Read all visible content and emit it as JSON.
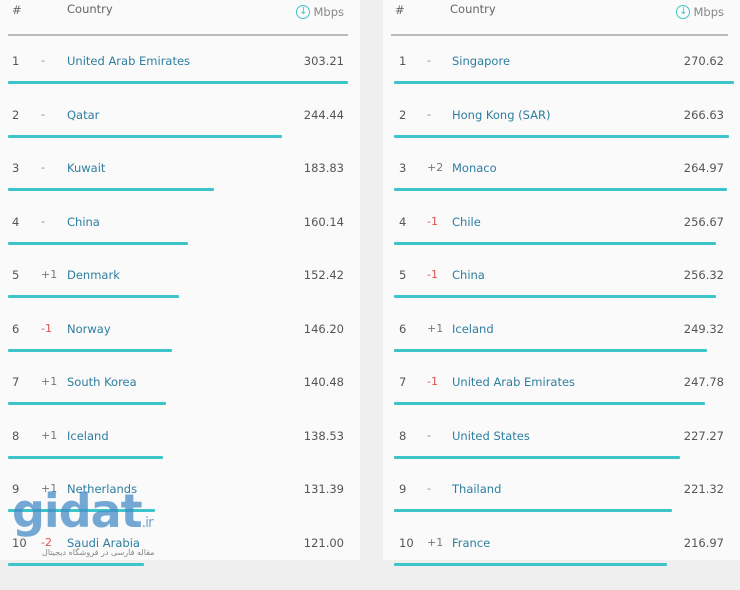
{
  "header": {
    "rank_label": "#",
    "country_label": "Country",
    "unit_label": "Mbps",
    "unit_icon": "download-circle-icon"
  },
  "colors": {
    "bar": "#3cc4c8",
    "country": "#2e7ea0",
    "down": "#d9534f"
  },
  "left": {
    "rows": [
      {
        "rank": "1",
        "change": "-",
        "country": "United Arab Emirates",
        "value": "303.21"
      },
      {
        "rank": "2",
        "change": "-",
        "country": "Qatar",
        "value": "244.44"
      },
      {
        "rank": "3",
        "change": "-",
        "country": "Kuwait",
        "value": "183.83"
      },
      {
        "rank": "4",
        "change": "-",
        "country": "China",
        "value": "160.14"
      },
      {
        "rank": "5",
        "change": "+1",
        "country": "Denmark",
        "value": "152.42"
      },
      {
        "rank": "6",
        "change": "-1",
        "country": "Norway",
        "value": "146.20"
      },
      {
        "rank": "7",
        "change": "+1",
        "country": "South Korea",
        "value": "140.48"
      },
      {
        "rank": "8",
        "change": "+1",
        "country": "Iceland",
        "value": "138.53"
      },
      {
        "rank": "9",
        "change": "+1",
        "country": "Netherlands",
        "value": "131.39"
      },
      {
        "rank": "10",
        "change": "-2",
        "country": "Saudi Arabia",
        "value": "121.00"
      }
    ]
  },
  "right": {
    "rows": [
      {
        "rank": "1",
        "change": "-",
        "country": "Singapore",
        "value": "270.62"
      },
      {
        "rank": "2",
        "change": "-",
        "country": "Hong Kong (SAR)",
        "value": "266.63"
      },
      {
        "rank": "3",
        "change": "+2",
        "country": "Monaco",
        "value": "264.97"
      },
      {
        "rank": "4",
        "change": "-1",
        "country": "Chile",
        "value": "256.67"
      },
      {
        "rank": "5",
        "change": "-1",
        "country": "China",
        "value": "256.32"
      },
      {
        "rank": "6",
        "change": "+1",
        "country": "Iceland",
        "value": "249.32"
      },
      {
        "rank": "7",
        "change": "-1",
        "country": "United Arab Emirates",
        "value": "247.78"
      },
      {
        "rank": "8",
        "change": "-",
        "country": "United States",
        "value": "227.27"
      },
      {
        "rank": "9",
        "change": "-",
        "country": "Thailand",
        "value": "221.32"
      },
      {
        "rank": "10",
        "change": "+1",
        "country": "France",
        "value": "216.97"
      }
    ]
  },
  "watermark": {
    "brand": "gidat",
    "tld": ".ir",
    "tagline": "مقاله فارسی در فروشگاه دیجیتال"
  }
}
